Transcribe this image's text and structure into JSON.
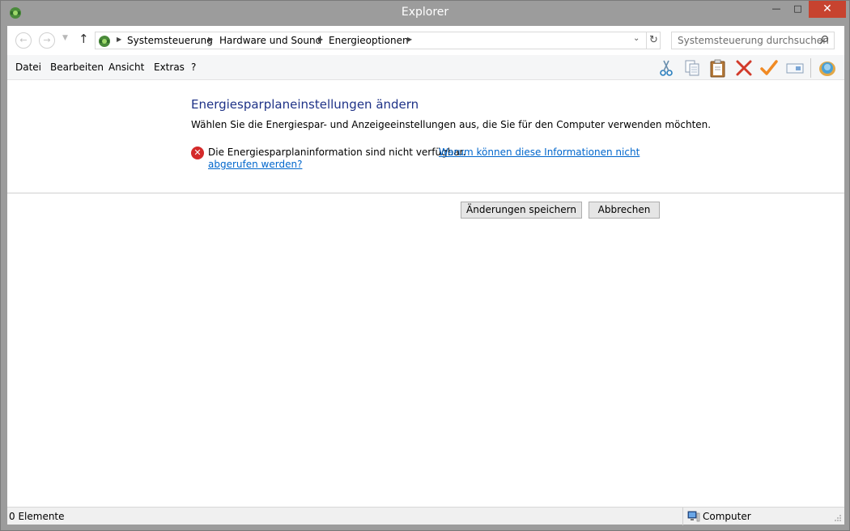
{
  "window": {
    "title": "Explorer",
    "close_glyph": "✕",
    "max_glyph": "□",
    "min_glyph": "—"
  },
  "nav": {
    "back_icon": "back-arrow-icon",
    "forward_icon": "forward-arrow-icon",
    "up_icon": "up-arrow-icon"
  },
  "breadcrumb": [
    "Systemsteuerung",
    "Hardware und Sound",
    "Energieoptionen"
  ],
  "search": {
    "placeholder": "Systemsteuerung durchsuchen"
  },
  "menu": {
    "file": "Datei",
    "edit": "Bearbeiten",
    "view": "Ansicht",
    "extras": "Extras",
    "help": "?"
  },
  "toolbar": [
    "scissors-icon",
    "copy-icon",
    "paste-icon",
    "delete-icon",
    "check-icon",
    "rename-icon",
    "shell-icon"
  ],
  "main": {
    "heading": "Energiesparplaneinstellungen ändern",
    "description": "Wählen Sie die Energiespar- und Anzeigeeinstellungen aus, die Sie für den Computer verwenden möchten.",
    "error_text": "Die Energiesparplaninformation sind nicht verfügbar.",
    "error_link_line1": "Warum können diese Informationen nicht",
    "error_link_line2": "abgerufen werden?",
    "save_button": "Änderungen speichern",
    "cancel_button": "Abbrechen"
  },
  "status": {
    "items": "0 Elemente",
    "location": "Computer"
  },
  "colors": {
    "heading": "#1e3287",
    "link": "#0066cc",
    "close": "#c7432f",
    "error": "#d42a2a"
  }
}
